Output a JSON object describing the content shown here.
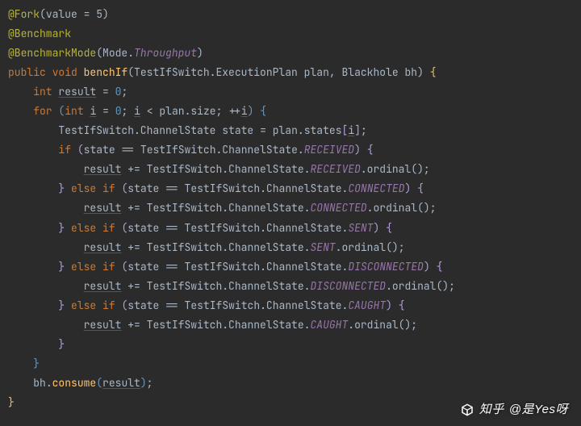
{
  "annotations": {
    "fork": "@Fork",
    "fork_args": "value = 5",
    "benchmark": "@Benchmark",
    "benchmarkMode": "@BenchmarkMode",
    "modePrefix": "Mode.",
    "modeValue": "Throughput"
  },
  "signature": {
    "modifiers": "public void",
    "name": "benchIf",
    "param1_type": "TestIfSwitch.ExecutionPlan",
    "param1_name": "plan",
    "param2_type": "Blackhole",
    "param2_name": "bh"
  },
  "body": {
    "decl_type": "int",
    "decl_name": "result",
    "decl_init": "0",
    "for_kw": "for",
    "for_decl": "int",
    "for_var": "i",
    "for_init": "0",
    "for_cond_rhs": "plan.size",
    "for_inc": "++",
    "state_type": "TestIfSwitch.ChannelState",
    "state_var": "state",
    "state_rhs_prefix": "plan.states",
    "branches": [
      {
        "const": "RECEIVED"
      },
      {
        "const": "CONNECTED"
      },
      {
        "const": "SENT"
      },
      {
        "const": "DISCONNECTED"
      },
      {
        "const": "CAUGHT"
      }
    ],
    "ordinal_call": ".ordinal()",
    "enum_path": "TestIfSwitch.ChannelState.",
    "consume_obj": "bh",
    "consume_fn": "consume",
    "consume_arg": "result"
  },
  "watermark": {
    "prefix": "知乎",
    "text": "@是Yes呀"
  }
}
